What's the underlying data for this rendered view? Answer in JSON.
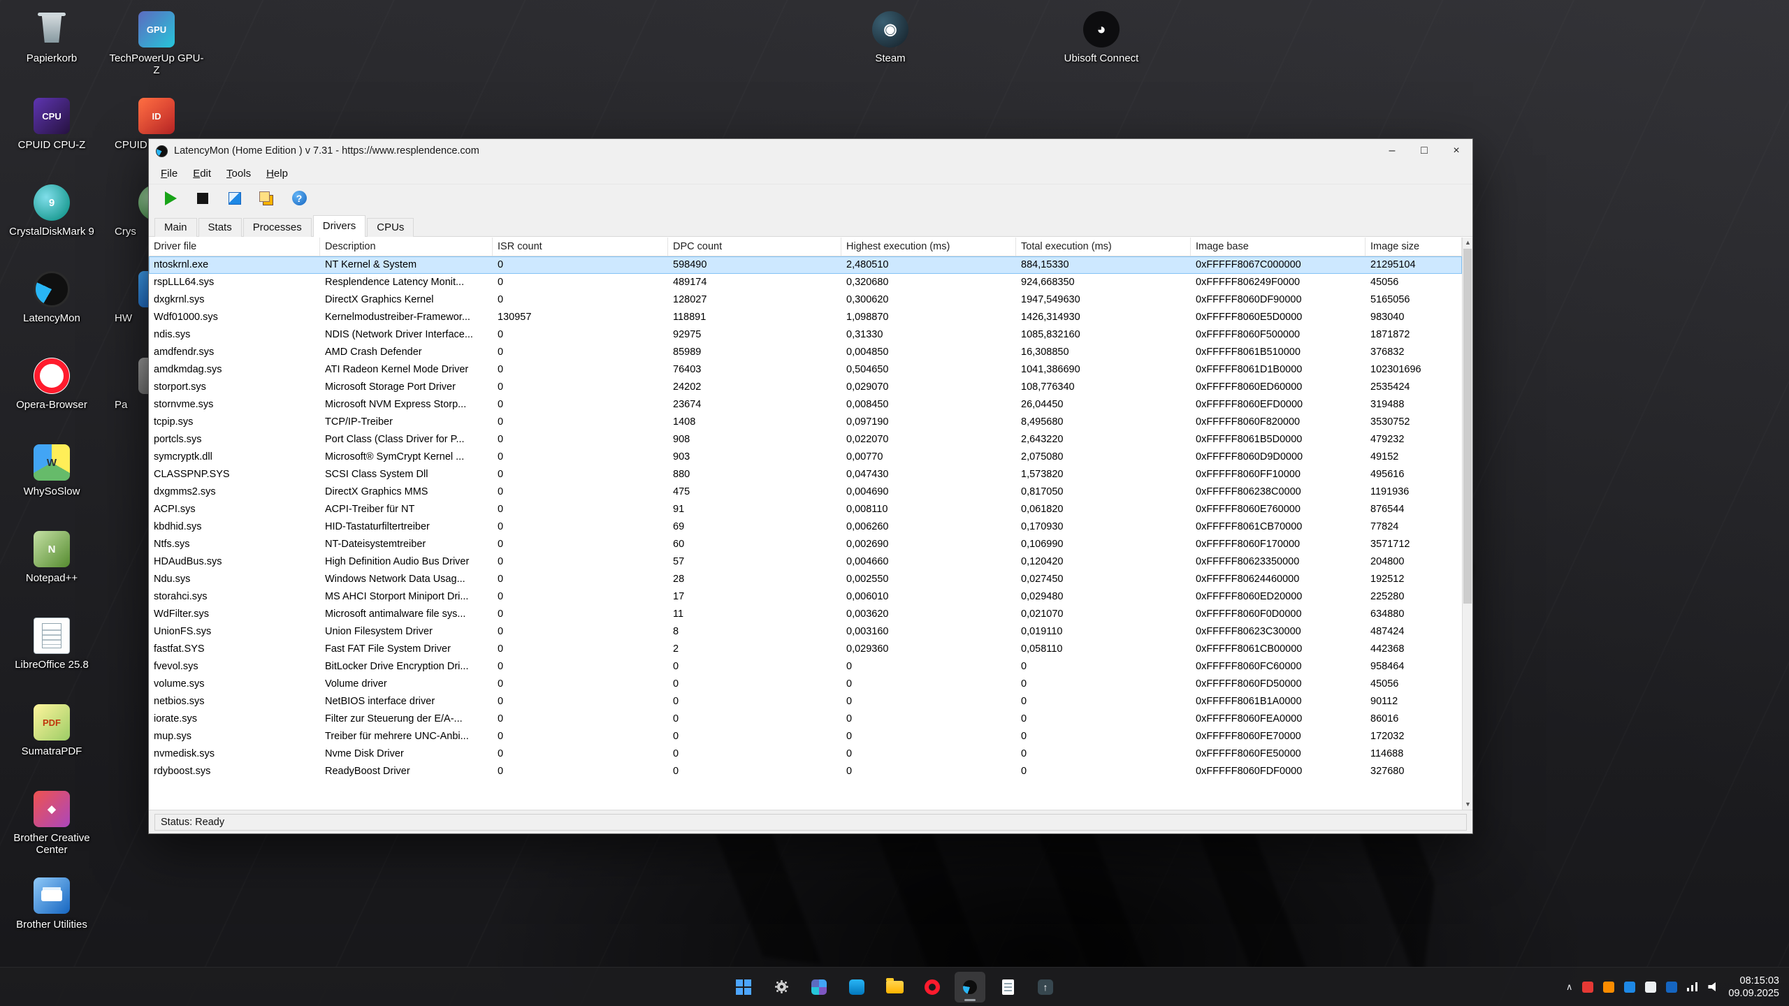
{
  "desktop": {
    "column1": [
      {
        "name": "desktop-icon-papierkorb",
        "label": "Papierkorb",
        "icon": "ic-recycle",
        "glyph": ""
      },
      {
        "name": "desktop-icon-cpuid-cpu-z",
        "label": "CPUID CPU-Z",
        "icon": "ic-cpuz",
        "glyph": "CPU"
      },
      {
        "name": "desktop-icon-crystaldiskmark",
        "label": "CrystalDiskMark 9",
        "icon": "ic-cdm",
        "glyph": "9"
      },
      {
        "name": "desktop-icon-latencymon",
        "label": "LatencyMon",
        "icon": "ic-latmon",
        "glyph": ""
      },
      {
        "name": "desktop-icon-opera-browser",
        "label": "Opera-Browser",
        "icon": "ic-opera",
        "glyph": ""
      },
      {
        "name": "desktop-icon-whysoslow",
        "label": "WhySoSlow",
        "icon": "ic-wss",
        "glyph": "W"
      },
      {
        "name": "desktop-icon-notepad-plus-plus",
        "label": "Notepad++",
        "icon": "ic-npp",
        "glyph": "N"
      },
      {
        "name": "desktop-icon-libreoffice",
        "label": "LibreOffice 25.8",
        "icon": "ic-lo",
        "glyph": ""
      },
      {
        "name": "desktop-icon-sumatrapdf",
        "label": "SumatraPDF",
        "icon": "ic-pdf",
        "glyph": "PDF"
      },
      {
        "name": "desktop-icon-brother-creative-center",
        "label": "Brother Creative Center",
        "icon": "ic-bcc",
        "glyph": "◆"
      },
      {
        "name": "desktop-icon-brother-utilities",
        "label": "Brother Utilities",
        "icon": "ic-bu",
        "glyph": ""
      }
    ],
    "column2": [
      {
        "name": "desktop-icon-gpu-z",
        "label": "TechPowerUp GPU-Z",
        "icon": "ic-gpuz",
        "glyph": "GPU"
      },
      {
        "name": "desktop-icon-cpuid",
        "label": "CPUID",
        "icon": "ic-cpuid",
        "glyph": "ID",
        "cls": "clipped"
      },
      {
        "name": "desktop-icon-crys",
        "label": "Crys",
        "icon": "ic-cdi",
        "glyph": "C",
        "cls": "clipped"
      },
      {
        "name": "desktop-icon-hw",
        "label": "HW",
        "icon": "ic-hw",
        "glyph": "HW",
        "cls": "clipped"
      },
      {
        "name": "desktop-icon-pa",
        "label": "Pa",
        "icon": "ic-pa",
        "glyph": "P",
        "cls": "clipped"
      }
    ],
    "top_icons": [
      {
        "name": "desktop-icon-steam",
        "label": "Steam",
        "icon": "ic-steam",
        "glyph": "◉",
        "cls": "pos-steam"
      },
      {
        "name": "desktop-icon-ubisoft-connect",
        "label": "Ubisoft Connect",
        "icon": "ic-ubi",
        "glyph": "◕",
        "cls": "pos-ubi"
      }
    ]
  },
  "window": {
    "title": "LatencyMon  (Home Edition )   v 7.31 - https://www.resplendence.com",
    "controls": {
      "minimize": "–",
      "maximize": "□",
      "close": "×"
    },
    "menu": [
      {
        "name": "menu-file",
        "label": "File"
      },
      {
        "name": "menu-edit",
        "label": "Edit"
      },
      {
        "name": "menu-tools",
        "label": "Tools"
      },
      {
        "name": "menu-help",
        "label": "Help"
      }
    ],
    "toolbar": [
      {
        "name": "start-monitor-button",
        "icon": "tbi-play",
        "glyph": ""
      },
      {
        "name": "stop-monitor-button",
        "icon": "tbi-stop",
        "glyph": ""
      },
      {
        "name": "report-button",
        "icon": "tbi-report",
        "glyph": ""
      },
      {
        "name": "copy-button",
        "icon": "tbi-copy",
        "glyph": ""
      },
      {
        "name": "help-button",
        "icon": "tbi-help",
        "glyph": "?"
      }
    ],
    "tabs": [
      {
        "name": "tab-main",
        "label": "Main"
      },
      {
        "name": "tab-stats",
        "label": "Stats"
      },
      {
        "name": "tab-processes",
        "label": "Processes"
      },
      {
        "name": "tab-drivers",
        "label": "Drivers",
        "active": true
      },
      {
        "name": "tab-cpus",
        "label": "CPUs"
      }
    ],
    "table": {
      "columns": [
        "Driver file",
        "Description",
        "ISR count",
        "DPC count",
        "Highest execution (ms)",
        "Total execution (ms)",
        "Image base",
        "Image size"
      ],
      "rows": [
        {
          "file": "ntoskrnl.exe",
          "description": "NT Kernel & System",
          "isr": "0",
          "dpc": "598490",
          "highest": "2,480510",
          "total": "884,15330",
          "base": "0xFFFFF8067C000000",
          "size": "21295104",
          "selected": true
        },
        {
          "file": "rspLLL64.sys",
          "description": "Resplendence Latency Monit...",
          "isr": "0",
          "dpc": "489174",
          "highest": "0,320680",
          "total": "924,668350",
          "base": "0xFFFFF806249F0000",
          "size": "45056"
        },
        {
          "file": "dxgkrnl.sys",
          "description": "DirectX Graphics Kernel",
          "isr": "0",
          "dpc": "128027",
          "highest": "0,300620",
          "total": "1947,549630",
          "base": "0xFFFFF8060DF90000",
          "size": "5165056"
        },
        {
          "file": "Wdf01000.sys",
          "description": "Kernelmodustreiber-Framewor...",
          "isr": "130957",
          "dpc": "118891",
          "highest": "1,098870",
          "total": "1426,314930",
          "base": "0xFFFFF8060E5D0000",
          "size": "983040"
        },
        {
          "file": "ndis.sys",
          "description": "NDIS (Network Driver Interface...",
          "isr": "0",
          "dpc": "92975",
          "highest": "0,31330",
          "total": "1085,832160",
          "base": "0xFFFFF8060F500000",
          "size": "1871872"
        },
        {
          "file": "amdfendr.sys",
          "description": "AMD Crash Defender",
          "isr": "0",
          "dpc": "85989",
          "highest": "0,004850",
          "total": "16,308850",
          "base": "0xFFFFF8061B510000",
          "size": "376832"
        },
        {
          "file": "amdkmdag.sys",
          "description": "ATI Radeon Kernel Mode Driver",
          "isr": "0",
          "dpc": "76403",
          "highest": "0,504650",
          "total": "1041,386690",
          "base": "0xFFFFF8061D1B0000",
          "size": "102301696"
        },
        {
          "file": "storport.sys",
          "description": "Microsoft Storage Port Driver",
          "isr": "0",
          "dpc": "24202",
          "highest": "0,029070",
          "total": "108,776340",
          "base": "0xFFFFF8060ED60000",
          "size": "2535424"
        },
        {
          "file": "stornvme.sys",
          "description": "Microsoft NVM Express Storp...",
          "isr": "0",
          "dpc": "23674",
          "highest": "0,008450",
          "total": "26,04450",
          "base": "0xFFFFF8060EFD0000",
          "size": "319488"
        },
        {
          "file": "tcpip.sys",
          "description": "TCP/IP-Treiber",
          "isr": "0",
          "dpc": "1408",
          "highest": "0,097190",
          "total": "8,495680",
          "base": "0xFFFFF8060F820000",
          "size": "3530752"
        },
        {
          "file": "portcls.sys",
          "description": "Port Class (Class Driver for P...",
          "isr": "0",
          "dpc": "908",
          "highest": "0,022070",
          "total": "2,643220",
          "base": "0xFFFFF8061B5D0000",
          "size": "479232"
        },
        {
          "file": "symcryptk.dll",
          "description": "Microsoft® SymCrypt Kernel ...",
          "isr": "0",
          "dpc": "903",
          "highest": "0,00770",
          "total": "2,075080",
          "base": "0xFFFFF8060D9D0000",
          "size": "49152"
        },
        {
          "file": "CLASSPNP.SYS",
          "description": "SCSI Class System Dll",
          "isr": "0",
          "dpc": "880",
          "highest": "0,047430",
          "total": "1,573820",
          "base": "0xFFFFF8060FF10000",
          "size": "495616"
        },
        {
          "file": "dxgmms2.sys",
          "description": "DirectX Graphics MMS",
          "isr": "0",
          "dpc": "475",
          "highest": "0,004690",
          "total": "0,817050",
          "base": "0xFFFFF806238C0000",
          "size": "1191936"
        },
        {
          "file": "ACPI.sys",
          "description": "ACPI-Treiber für NT",
          "isr": "0",
          "dpc": "91",
          "highest": "0,008110",
          "total": "0,061820",
          "base": "0xFFFFF8060E760000",
          "size": "876544"
        },
        {
          "file": "kbdhid.sys",
          "description": "HID-Tastaturfiltertreiber",
          "isr": "0",
          "dpc": "69",
          "highest": "0,006260",
          "total": "0,170930",
          "base": "0xFFFFF8061CB70000",
          "size": "77824"
        },
        {
          "file": "Ntfs.sys",
          "description": "NT-Dateisystemtreiber",
          "isr": "0",
          "dpc": "60",
          "highest": "0,002690",
          "total": "0,106990",
          "base": "0xFFFFF8060F170000",
          "size": "3571712"
        },
        {
          "file": "HDAudBus.sys",
          "description": "High Definition Audio Bus Driver",
          "isr": "0",
          "dpc": "57",
          "highest": "0,004660",
          "total": "0,120420",
          "base": "0xFFFFF80623350000",
          "size": "204800"
        },
        {
          "file": "Ndu.sys",
          "description": "Windows Network Data Usag...",
          "isr": "0",
          "dpc": "28",
          "highest": "0,002550",
          "total": "0,027450",
          "base": "0xFFFFF80624460000",
          "size": "192512"
        },
        {
          "file": "storahci.sys",
          "description": "MS AHCI Storport Miniport Dri...",
          "isr": "0",
          "dpc": "17",
          "highest": "0,006010",
          "total": "0,029480",
          "base": "0xFFFFF8060ED20000",
          "size": "225280"
        },
        {
          "file": "WdFilter.sys",
          "description": "Microsoft antimalware file sys...",
          "isr": "0",
          "dpc": "11",
          "highest": "0,003620",
          "total": "0,021070",
          "base": "0xFFFFF8060F0D0000",
          "size": "634880"
        },
        {
          "file": "UnionFS.sys",
          "description": "Union Filesystem Driver",
          "isr": "0",
          "dpc": "8",
          "highest": "0,003160",
          "total": "0,019110",
          "base": "0xFFFFF80623C30000",
          "size": "487424"
        },
        {
          "file": "fastfat.SYS",
          "description": "Fast FAT File System Driver",
          "isr": "0",
          "dpc": "2",
          "highest": "0,029360",
          "total": "0,058110",
          "base": "0xFFFFF8061CB00000",
          "size": "442368"
        },
        {
          "file": "fvevol.sys",
          "description": "BitLocker Drive Encryption Dri...",
          "isr": "0",
          "dpc": "0",
          "highest": "0",
          "total": "0",
          "base": "0xFFFFF8060FC60000",
          "size": "958464"
        },
        {
          "file": "volume.sys",
          "description": "Volume driver",
          "isr": "0",
          "dpc": "0",
          "highest": "0",
          "total": "0",
          "base": "0xFFFFF8060FD50000",
          "size": "45056"
        },
        {
          "file": "netbios.sys",
          "description": "NetBIOS interface driver",
          "isr": "0",
          "dpc": "0",
          "highest": "0",
          "total": "0",
          "base": "0xFFFFF8061B1A0000",
          "size": "90112"
        },
        {
          "file": "iorate.sys",
          "description": "Filter zur Steuerung der E/A-...",
          "isr": "0",
          "dpc": "0",
          "highest": "0",
          "total": "0",
          "base": "0xFFFFF8060FEA0000",
          "size": "86016"
        },
        {
          "file": "mup.sys",
          "description": "Treiber für mehrere UNC-Anbi...",
          "isr": "0",
          "dpc": "0",
          "highest": "0",
          "total": "0",
          "base": "0xFFFFF8060FE70000",
          "size": "172032"
        },
        {
          "file": "nvmedisk.sys",
          "description": "Nvme Disk Driver",
          "isr": "0",
          "dpc": "0",
          "highest": "0",
          "total": "0",
          "base": "0xFFFFF8060FE50000",
          "size": "114688"
        },
        {
          "file": "rdyboost.sys",
          "description": "ReadyBoost Driver",
          "isr": "0",
          "dpc": "0",
          "highest": "0",
          "total": "0",
          "base": "0xFFFFF8060FDF0000",
          "size": "327680"
        }
      ]
    },
    "scrollbar": {
      "up": "▲",
      "down": "▼"
    },
    "status": "Status: Ready"
  },
  "taskbar": {
    "items": [
      {
        "name": "start-button",
        "icon": "tk-start",
        "glyph": ""
      },
      {
        "name": "settings-button",
        "icon": "tk-gear",
        "glyph": ""
      },
      {
        "name": "photos-app-button",
        "icon": "tk-photos",
        "glyph": ""
      },
      {
        "name": "store-app-button",
        "icon": "tk-store",
        "glyph": ""
      },
      {
        "name": "file-explorer-button",
        "icon": "tk-folder",
        "glyph": ""
      },
      {
        "name": "opera-button",
        "icon": "tk-opera",
        "glyph": ""
      },
      {
        "name": "latencymon-button",
        "icon": "tk-latmon",
        "glyph": "",
        "active": true
      },
      {
        "name": "document-app-button",
        "icon": "tk-doc",
        "glyph": ""
      },
      {
        "name": "arrow-app-button",
        "icon": "tk-arrow",
        "glyph": "↑"
      }
    ],
    "tray": [
      {
        "name": "hidden-icons-chevron",
        "icon": "tr-chev",
        "glyph": "∧"
      },
      {
        "name": "tray-app-red",
        "icon": "tr-red",
        "glyph": ""
      },
      {
        "name": "tray-app-orange",
        "icon": "tr-orange",
        "glyph": ""
      },
      {
        "name": "tray-app-blue",
        "icon": "tr-blue",
        "glyph": ""
      },
      {
        "name": "tray-app-light",
        "icon": "tr-light",
        "glyph": ""
      },
      {
        "name": "bluetooth-tray-icon",
        "icon": "tr-bt",
        "glyph": ""
      },
      {
        "name": "network-icon",
        "icon": "tr-net",
        "glyph": ""
      },
      {
        "name": "volume-icon",
        "icon": "tr-vol",
        "glyph": ""
      }
    ],
    "clock": {
      "time": "08:15:03",
      "date": "09.09.2025"
    }
  }
}
